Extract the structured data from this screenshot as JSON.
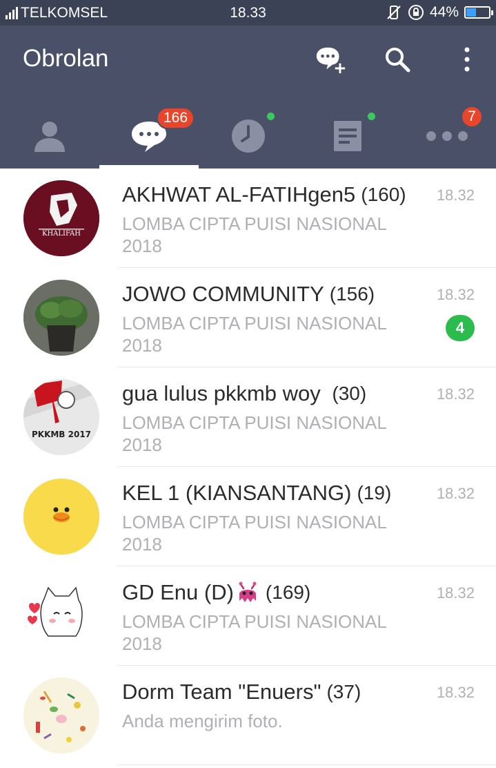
{
  "status_bar": {
    "carrier": "TELKOMSEL",
    "time": "18.33",
    "battery": "44%"
  },
  "header": {
    "title": "Obrolan"
  },
  "tabs": [
    {
      "name": "friends",
      "badge": ""
    },
    {
      "name": "chats",
      "badge": "166"
    },
    {
      "name": "timeline",
      "badge": ""
    },
    {
      "name": "news",
      "badge": ""
    },
    {
      "name": "more",
      "badge": "7"
    }
  ],
  "chats": [
    {
      "name": "AKHWAT AL-FATIHgen5",
      "count": "(160)",
      "preview": "LOMBA CIPTA PUISI NASIONAL 2018",
      "time": "18.32",
      "unread": "",
      "avatar_text": "KHALIFAH"
    },
    {
      "name": "JOWO COMMUNITY",
      "count": "(156)",
      "preview": "LOMBA CIPTA PUISI NASIONAL 2018",
      "time": "18.32",
      "unread": "4",
      "avatar_text": ""
    },
    {
      "name": "gua lulus pkkmb woy ",
      "count": "(30)",
      "preview": "LOMBA CIPTA PUISI NASIONAL 2018",
      "time": "18.32",
      "unread": "",
      "avatar_text": "PKKMB 2017"
    },
    {
      "name": "KEL 1 (KIANSANTANG)",
      "count": "(19)",
      "preview": "LOMBA CIPTA PUISI NASIONAL 2018",
      "time": "18.32",
      "unread": "",
      "avatar_text": ""
    },
    {
      "name": "GD Enu (D)",
      "count": "(169)",
      "preview": "LOMBA CIPTA PUISI NASIONAL 2018",
      "time": "18.32",
      "unread": "",
      "avatar_text": ""
    },
    {
      "name": "Dorm Team \"Enuers\"",
      "count": "(37)",
      "preview": "Anda mengirim foto.",
      "time": "18.32",
      "unread": "",
      "avatar_text": ""
    }
  ],
  "colors": {
    "header_bg": "#4a5068",
    "status_bg": "#3b4255",
    "badge_red": "#e8452a",
    "unread_green": "#2cbc4e"
  }
}
